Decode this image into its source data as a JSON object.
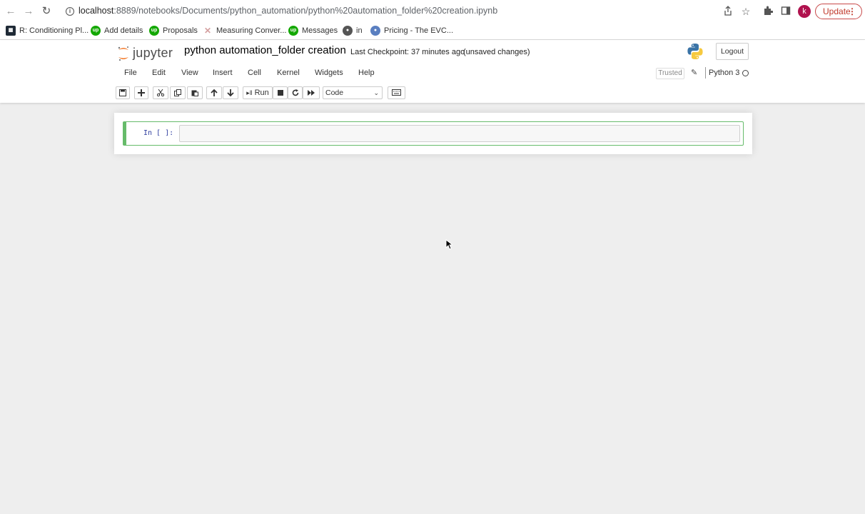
{
  "browser": {
    "url_host": "localhost",
    "url_path": ":8889/notebooks/Documents/python_automation/python%20automation_folder%20creation.ipynb",
    "profile_initial": "k",
    "update_label": "Update",
    "update_menu": "⋮"
  },
  "bookmarks": [
    {
      "label": "R: Conditioning Pl...",
      "icon": "bookmark-site-icon"
    },
    {
      "label": "Add details",
      "icon": "upwork-icon"
    },
    {
      "label": "Proposals",
      "icon": "upwork-icon"
    },
    {
      "label": "Measuring Conver...",
      "icon": "bookmark-site-icon"
    },
    {
      "label": "Messages",
      "icon": "upwork-icon"
    },
    {
      "label": "in",
      "icon": "globe-icon"
    },
    {
      "label": "Pricing - The EVC...",
      "icon": "bookmark-site-icon"
    }
  ],
  "header": {
    "logo_text": "jupyter",
    "notebook_title": "python automation_folder creation",
    "checkpoint": "Last Checkpoint: 37 minutes ago",
    "unsaved": "(unsaved changes)",
    "logout": "Logout"
  },
  "menu": {
    "items": [
      "File",
      "Edit",
      "View",
      "Insert",
      "Cell",
      "Kernel",
      "Widgets",
      "Help"
    ],
    "trusted": "Trusted",
    "kernel_name": "Python 3"
  },
  "toolbar": {
    "run_label": "Run",
    "cell_type": "Code"
  },
  "cell": {
    "prompt": "In [ ]:",
    "content": ""
  },
  "colors": {
    "cell_border": "#66bb6a",
    "prompt": "#303f9f",
    "update": "#c0392b",
    "avatar": "#b0124e"
  }
}
